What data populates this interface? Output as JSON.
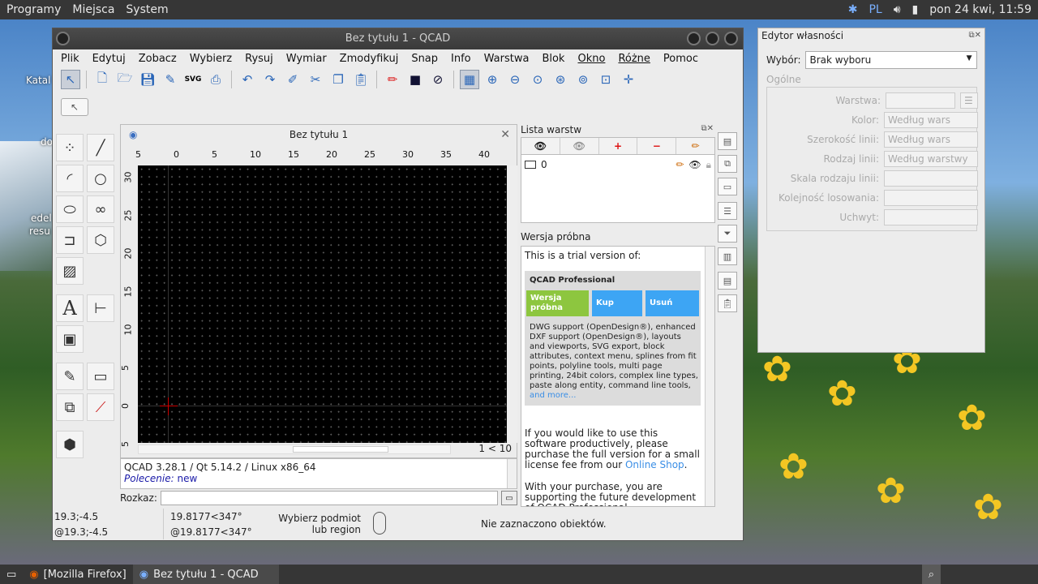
{
  "topbar": {
    "menus": [
      "Programy",
      "Miejsca",
      "System"
    ],
    "lang": "PL",
    "clock": "pon 24 kwi, 11:59",
    "icons": [
      "bluetooth-icon",
      "volume-icon",
      "signal-icon"
    ]
  },
  "desktop": {
    "labels": [
      "Katal",
      "do",
      "edel",
      "resu"
    ]
  },
  "window": {
    "title": "Bez tytułu 1 - QCAD"
  },
  "menubar": {
    "items": [
      "Plik",
      "Edytuj",
      "Zobacz",
      "Wybierz",
      "Rysuj",
      "Wymiar",
      "Zmodyfikuj",
      "Snap",
      "Info",
      "Warstwa",
      "Blok",
      "Okno",
      "Różne",
      "Pomoc"
    ]
  },
  "drawing": {
    "title": "Bez tytułu 1",
    "ruler_h": [
      "5",
      "0",
      "5",
      "10",
      "15",
      "20",
      "25",
      "30",
      "35",
      "40"
    ],
    "ruler_v": [
      "30",
      "25",
      "20",
      "15",
      "10",
      "5",
      "0",
      "5"
    ],
    "scale": "1 < 10"
  },
  "console": {
    "line1": "QCAD 3.28.1 / Qt 5.14.2 / Linux x86_64",
    "prompt_label": "Polecenie:",
    "prompt_value": "new",
    "cmd_label": "Rozkaz:"
  },
  "status": {
    "abs": "19.3;-4.5",
    "rel": "@19.3;-4.5",
    "polar": "19.8177<347°",
    "polar_rel": "@19.8177<347°",
    "hint1": "Wybierz podmiot",
    "hint2": "lub region",
    "selection": "Nie zaznaczono obiektów."
  },
  "layers": {
    "title": "Lista warstw",
    "items": [
      {
        "name": "0"
      }
    ]
  },
  "trial": {
    "title": "Wersja próbna",
    "intro": "This is a trial version of:",
    "product": "QCAD Professional",
    "btn_trial": "Wersja próbna",
    "btn_buy": "Kup",
    "btn_remove": "Usuń",
    "features": "DWG support (OpenDesign®), enhanced DXF support (OpenDesign®), layouts and viewports, SVG export, block attributes, context menu, splines from fit points, polyline tools, multi page printing, 24bit colors, complex line types, paste along entity, command line tools,",
    "more": "and more...",
    "p1": "If you would like to use this software productively, please purchase the full version for a small license fee from our",
    "shop": "Online Shop",
    "p2": "With your purchase, you are supporting the future development of QCAD Professional"
  },
  "props": {
    "title": "Edytor własności",
    "sel_label": "Wybór:",
    "sel_value": "Brak wyboru",
    "group": "Ogólne",
    "rows": [
      {
        "label": "Warstwa:",
        "value": ""
      },
      {
        "label": "Kolor:",
        "value": "Według wars"
      },
      {
        "label": "Szerokość linii:",
        "value": "Według wars"
      },
      {
        "label": "Rodzaj linii:",
        "value": "Według warstwy"
      },
      {
        "label": "Skala rodzaju linii:",
        "value": ""
      },
      {
        "label": "Kolejność losowania:",
        "value": ""
      },
      {
        "label": "Uchwyt:",
        "value": ""
      }
    ]
  },
  "taskbar": {
    "items": [
      "[Mozilla Firefox]",
      "Bez tytułu 1 - QCAD"
    ]
  },
  "colors": {
    "trial_green": "#8dc63f",
    "trial_blue": "#3da5f4",
    "link": "#3a8ee6"
  }
}
